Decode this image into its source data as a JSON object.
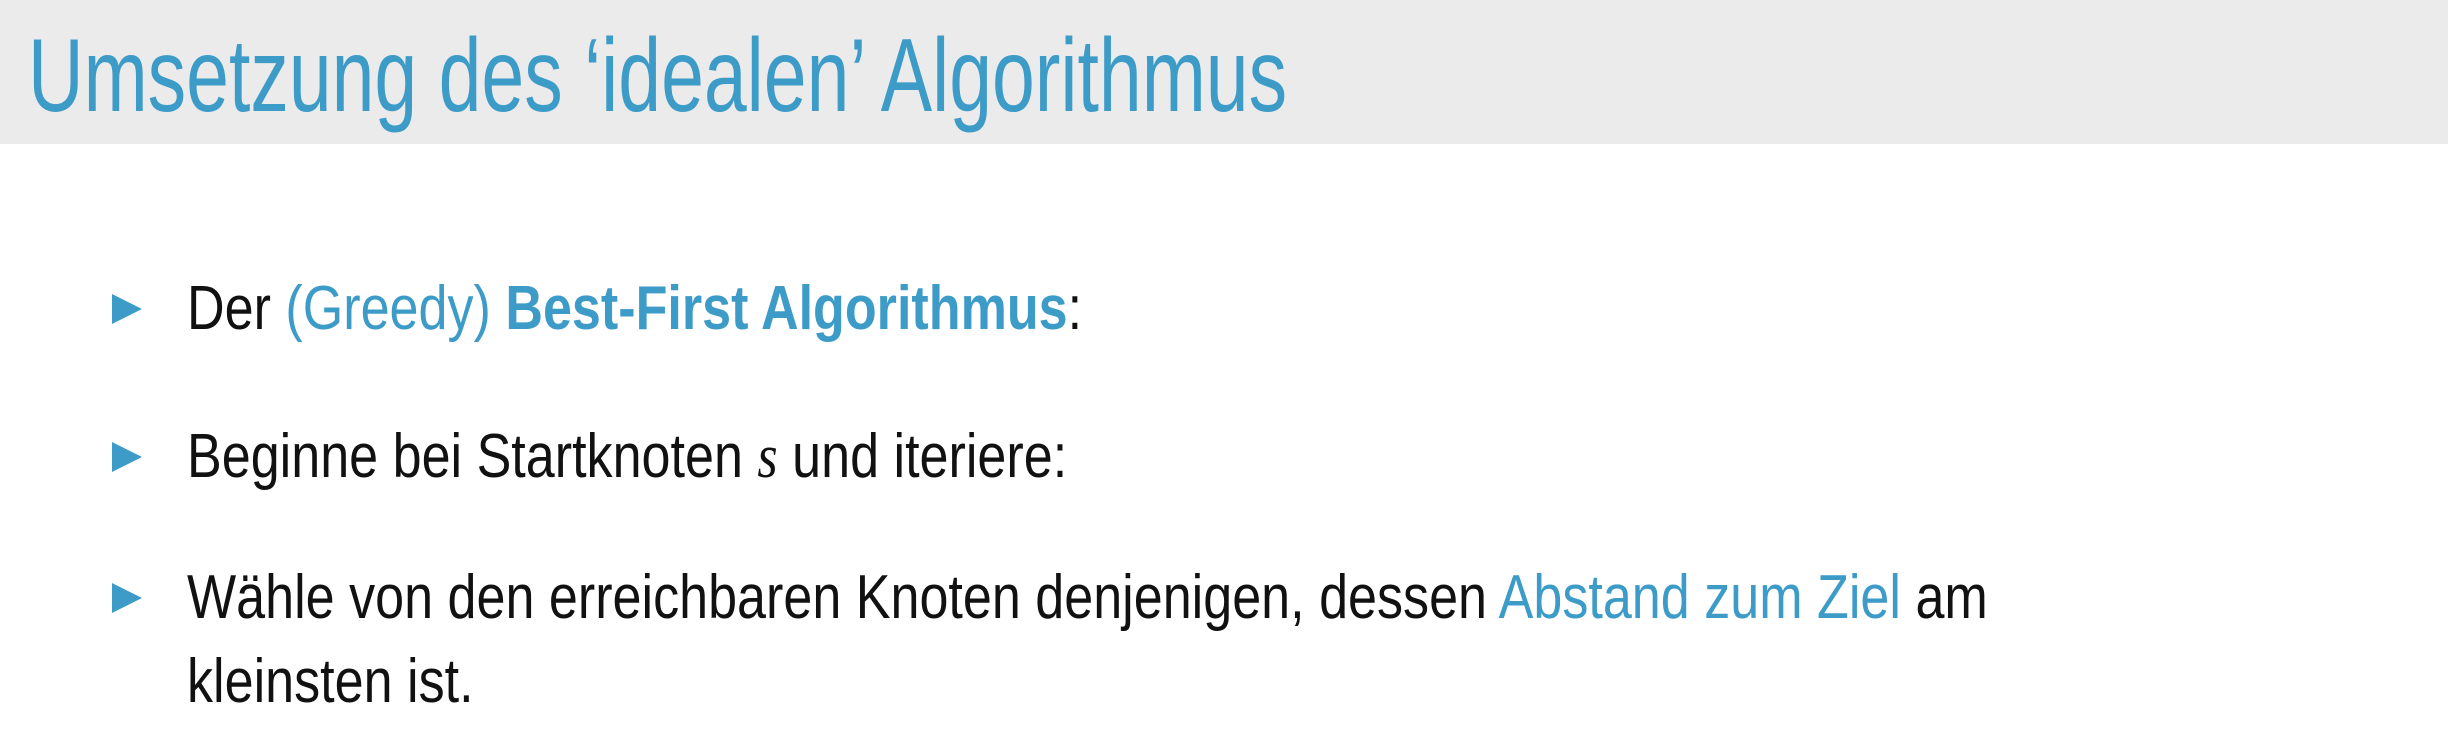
{
  "title": "Umsetzung des ‘idealen’ Algorithmus",
  "bullets": [
    {
      "pre": "Der ",
      "greedy": "(Greedy)",
      "space": " ",
      "bold": "Best-First Algorithmus",
      "post": ":"
    },
    {
      "pre": "Beginne bei Startknoten ",
      "math": "s",
      "post": " und iteriere:"
    },
    {
      "pre": "Wähle von den erreichbaren Knoten denjenigen, dessen ",
      "highlight": "Abstand zum Ziel",
      "post": " am",
      "cont": "kleinsten ist."
    }
  ],
  "colors": {
    "accent": "#3d9bc8",
    "header_bg": "#ebebeb"
  },
  "icons": {
    "bullet": "triangle-right-icon"
  }
}
